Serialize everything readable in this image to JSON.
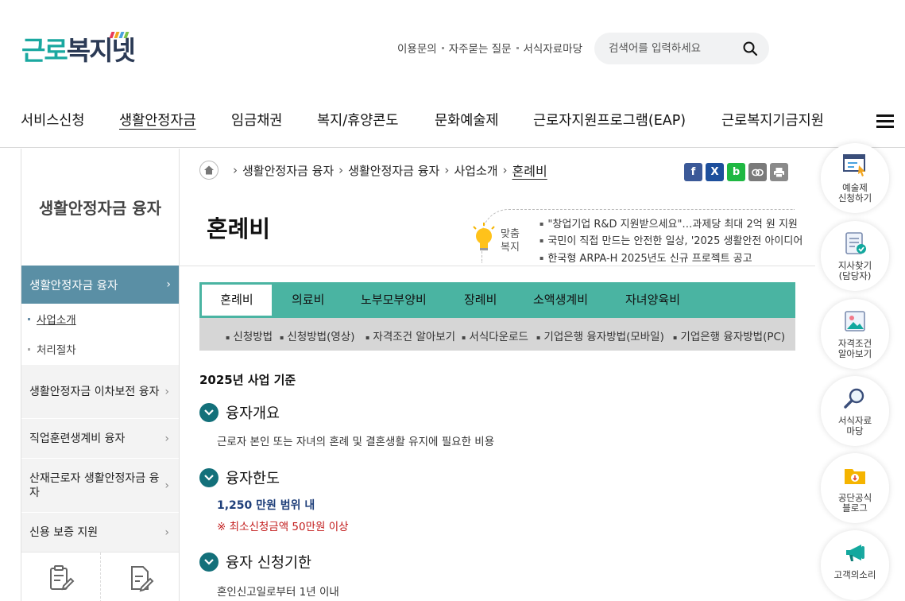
{
  "logo": {
    "text_part1": "근로",
    "text_part2": "복지넷"
  },
  "header": {
    "util_links": [
      "이용문의",
      "자주묻는 질문",
      "서식자료마당"
    ],
    "search_placeholder": "검색어를 입력하세요"
  },
  "gnb": {
    "items": [
      "서비스신청",
      "생활안정자금",
      "임금채권",
      "복지/휴양콘도",
      "문화예술제",
      "근로자지원프로그램(EAP)",
      "근로복지기금지원"
    ]
  },
  "sidebar": {
    "title": "생활안정자금 융자",
    "active_item": "생활안정자금 융자",
    "sub_items": [
      "사업소개",
      "처리절차"
    ],
    "items": [
      "생활안정자금 이차보전 융자",
      "직업훈련생계비 융자",
      "산재근로자 생활안정자금 융자",
      "신용 보증 지원"
    ]
  },
  "breadcrumb": [
    "생활안정자금 융자",
    "생활안정자금 융자",
    "사업소개",
    "혼례비"
  ],
  "share": {
    "facebook": "f",
    "x": "X",
    "band": "b"
  },
  "page_title": "혼례비",
  "custom_welfare": {
    "label_line1": "맞춤",
    "label_line2": "복지",
    "news": [
      "\"창업기업 R&D 지원받으세요\"…과제당 최대 2억 원 지원",
      "국민이 직접 만드는 안전한 일상, '2025 생활안전 아이디어",
      "한국형 ARPA-H 2025년도 신규 프로젝트 공고"
    ]
  },
  "tabs": [
    "혼례비",
    "의료비",
    "노부모부양비",
    "장례비",
    "소액생계비",
    "자녀양육비"
  ],
  "subtabs": [
    "신청방법",
    "신청방법(영상)",
    "자격조건 알아보기",
    "서식다운로드",
    "기업은행 융자방법(모바일)",
    "기업은행 융자방법(PC)"
  ],
  "content": {
    "basis": "2025년 사업 기준",
    "sections": [
      {
        "heading": "융자개요",
        "text": "근로자 본인 또는 자녀의 혼례 및 결혼생활 유지에 필요한 비용"
      },
      {
        "heading": "융자한도",
        "amount": "1,250 만원 범위 내",
        "note": "※ 최소신청금액 50만원 이상"
      },
      {
        "heading": "융자 신청기한",
        "text": "혼인신고일로부터 1년 이내"
      }
    ]
  },
  "quick_menu": [
    {
      "label": "예술제\n신청하기",
      "icon": "monitor-icon"
    },
    {
      "label": "지사찾기\n(담당자)",
      "icon": "checklist-icon"
    },
    {
      "label": "자격조건\n알아보기",
      "icon": "image-icon"
    },
    {
      "label": "서식자료\n마당",
      "icon": "magnifier-icon"
    },
    {
      "label": "공단공식\n블로그",
      "icon": "folder-icon"
    },
    {
      "label": "고객의소리",
      "icon": "megaphone-icon"
    }
  ],
  "colors": {
    "brand_teal": "#1aa8a0",
    "brand_navy": "#2b3a55",
    "tab_bar": "#4ab4a2",
    "sidebar_active": "#5a8fa5",
    "section_circle": "#13707a",
    "amount_text": "#1f3f7a",
    "note_text": "#c21b1b"
  }
}
